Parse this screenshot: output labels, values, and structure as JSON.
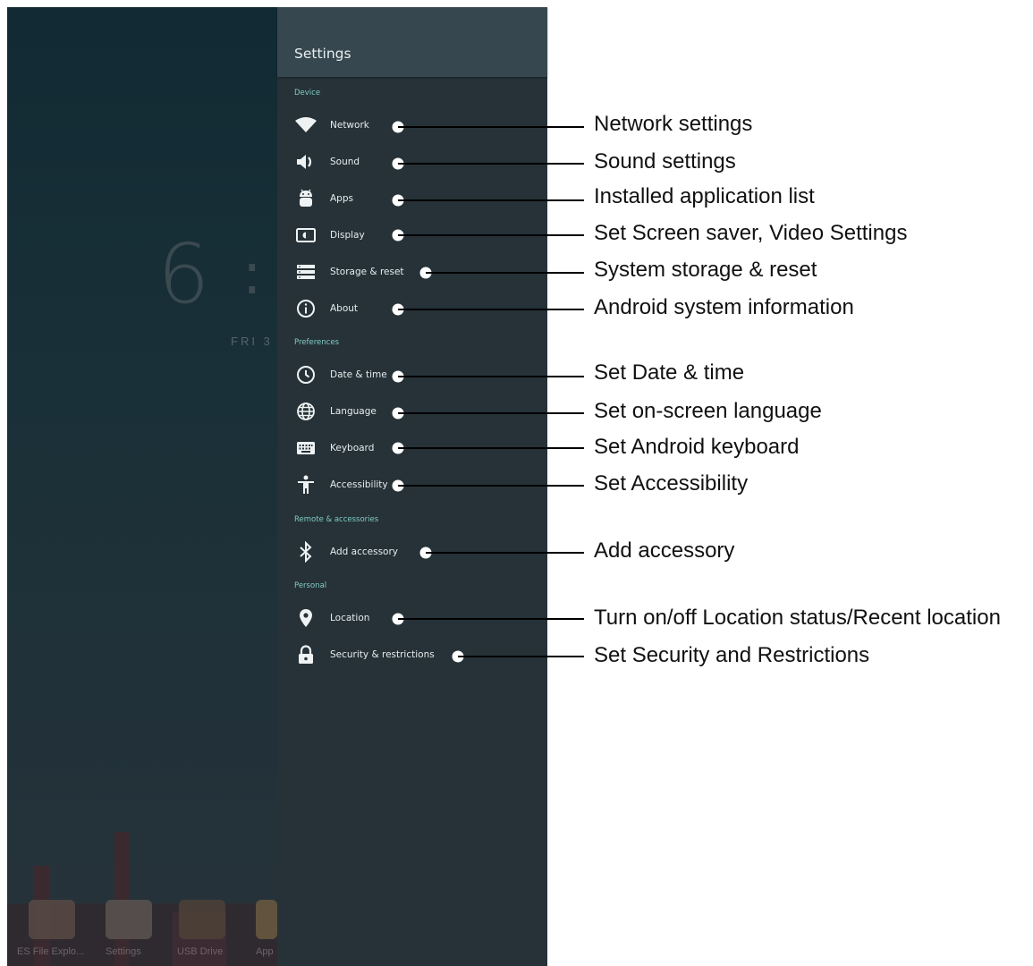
{
  "background": {
    "clock_digit": "6",
    "clock_colon": ":",
    "date_text": "FRI 3",
    "dock": [
      {
        "label": "ES File Explo..."
      },
      {
        "label": "Settings"
      },
      {
        "label": "USB Drive"
      },
      {
        "label": "App"
      }
    ]
  },
  "panel": {
    "title": "Settings",
    "sections": {
      "device": "Device",
      "preferences": "Preferences",
      "remote": "Remote & accessories",
      "personal": "Personal"
    },
    "items": [
      {
        "label": "Network",
        "icon": "wifi-icon",
        "annotation": "Network settings"
      },
      {
        "label": "Sound",
        "icon": "speaker-icon",
        "annotation": "Sound settings"
      },
      {
        "label": "Apps",
        "icon": "android-icon",
        "annotation": "Installed application list"
      },
      {
        "label": "Display",
        "icon": "display-icon",
        "annotation": "Set Screen saver, Video Settings"
      },
      {
        "label": "Storage & reset",
        "icon": "storage-icon",
        "annotation": "System storage & reset"
      },
      {
        "label": "About",
        "icon": "info-icon",
        "annotation": "Android system information"
      },
      {
        "label": "Date & time",
        "icon": "clock-icon",
        "annotation": "Set Date & time"
      },
      {
        "label": "Language",
        "icon": "globe-icon",
        "annotation": "Set on-screen language"
      },
      {
        "label": "Keyboard",
        "icon": "keyboard-icon",
        "annotation": "Set Android keyboard"
      },
      {
        "label": "Accessibility",
        "icon": "accessibility-icon",
        "annotation": "Set Accessibility"
      },
      {
        "label": "Add accessory",
        "icon": "bluetooth-icon",
        "annotation": "Add accessory"
      },
      {
        "label": "Location",
        "icon": "location-pin-icon",
        "annotation": "Turn on/off Location status/Recent location"
      },
      {
        "label": "Security & restrictions",
        "icon": "lock-icon",
        "annotation": "Set Security and Restrictions"
      }
    ]
  },
  "colors": {
    "panel_bg": "#263238",
    "header_bg": "#37474f",
    "section_text": "#80cbc4",
    "item_text": "#e6ecee"
  }
}
